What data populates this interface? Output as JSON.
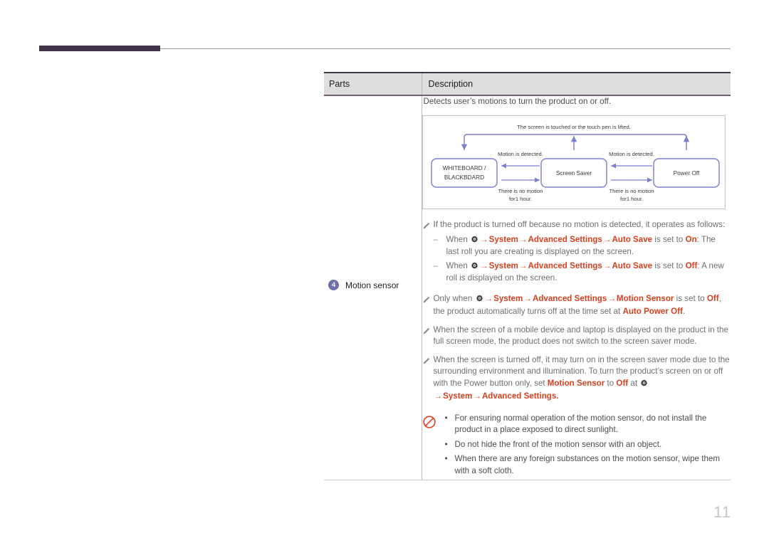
{
  "page": {
    "number": "11"
  },
  "table": {
    "headers": {
      "parts": "Parts",
      "description": "Description"
    },
    "row": {
      "badge": "4",
      "part_name": "Motion sensor",
      "intro": "Detects user’s motions to turn the product on or off."
    }
  },
  "diagram": {
    "top_label": "The screen is touched or the touch pen is lifted.",
    "nodes": [
      {
        "id": "whiteboard",
        "line1": "WHITEBOARD /",
        "line2": "BLACKBDARD"
      },
      {
        "id": "screen-saver",
        "line1": "Screen Saver",
        "line2": ""
      },
      {
        "id": "power-off",
        "line1": "Power Off",
        "line2": ""
      }
    ],
    "edges": {
      "motion_left": "Motion is detected.",
      "motion_right": "Motion is detected.",
      "nomotion_left_line1": "There is no motion",
      "nomotion_left_line2": "for1 hour.",
      "nomotion_right_line1": "There is no motion",
      "nomotion_right_line2": "for1 hour."
    },
    "colors": {
      "node_stroke": "#7b7fd0",
      "arrow": "#7b7fd0",
      "frame": "#c4c4c4"
    }
  },
  "notes": {
    "note1": {
      "text": "If the product is turned off because no motion is detected, it operates as follows:",
      "subitems": [
        {
          "lead": "When",
          "path": [
            "System",
            "Advanced Settings",
            "Auto Save"
          ],
          "mid": "is set to",
          "state": "On",
          "tail": ": The last roll you are creating is displayed on the screen."
        },
        {
          "lead": "When",
          "path": [
            "System",
            "Advanced Settings",
            "Auto Save"
          ],
          "mid": "is set to",
          "state": "Off",
          "tail": ": A new roll is displayed on the screen."
        }
      ]
    },
    "note2": {
      "lead": "Only when",
      "path": [
        "System",
        "Advanced Settings",
        "Motion Sensor"
      ],
      "mid": "is set to",
      "state": "Off",
      "tail1": ", the product automatically turns off at the time set at",
      "state2": "Auto Power Off",
      "tail2": "."
    },
    "note3": {
      "text": "When the screen of a mobile device and laptop is displayed on the product in the full screen mode, the product does not switch to the screen saver mode."
    },
    "note4": {
      "part1": "When the screen is turned off, it may turn on in the screen saver mode due to the surrounding environment and illumination. To turn the product’s screen on or off with the Power button only, set",
      "term1": "Motion Sensor",
      "mid1": "to",
      "term2": "Off",
      "mid2": "at",
      "path": [
        "System",
        "Advanced Settings"
      ],
      "tail": "."
    }
  },
  "warning": {
    "items": [
      "For ensuring normal operation of the motion sensor, do not install the product in a place exposed to direct sunlight.",
      "Do not hide the front of the motion sensor with an object.",
      "When there are any foreign substances on the motion sensor, wipe them with a soft cloth."
    ]
  },
  "colors": {
    "accent": "#d9401f",
    "header_bar": "#3f3347",
    "badge": "#6d6fa8",
    "diagram_stroke": "#7b7fd0",
    "prohibition": "#e0401f"
  }
}
